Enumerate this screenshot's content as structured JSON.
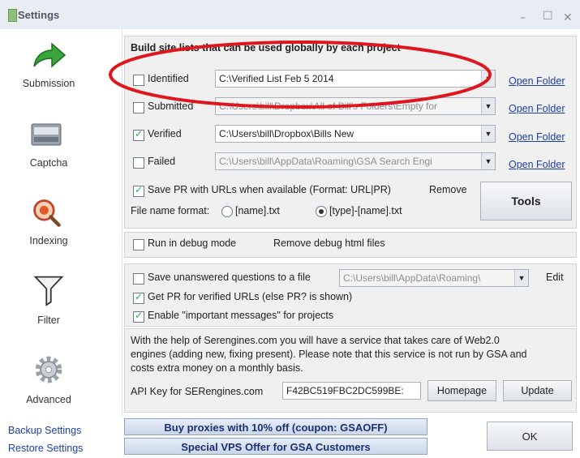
{
  "window": {
    "title": "Settings",
    "minimize": "–",
    "maximize": "☐",
    "close": "✕"
  },
  "sidebar": {
    "items": [
      {
        "label": "Submission",
        "icon": "arrow-right-icon"
      },
      {
        "label": "Captcha",
        "icon": "captcha-icon"
      },
      {
        "label": "Indexing",
        "icon": "indexing-icon"
      },
      {
        "label": "Filter",
        "icon": "filter-funnel-icon"
      },
      {
        "label": "Advanced",
        "icon": "gear-icon"
      }
    ],
    "backup": "Backup Settings",
    "restore": "Restore Settings"
  },
  "sitelists": {
    "heading": "Build site lists that can be used globally by each project",
    "rows": [
      {
        "label": "Identified",
        "checked": false,
        "path": "C:\\Verified List Feb 5 2014",
        "enabled": true,
        "link": "Open Folder"
      },
      {
        "label": "Submitted",
        "checked": false,
        "path": "C:\\Users\\bill\\Dropbox\\All of Bill's Folders\\Empty for",
        "enabled": false,
        "link": "Open Folder"
      },
      {
        "label": "Verified",
        "checked": true,
        "path": "C:\\Users\\bill\\Dropbox\\Bills New",
        "enabled": true,
        "link": "Open Folder"
      },
      {
        "label": "Failed",
        "checked": false,
        "path": "C:\\Users\\bill\\AppData\\Roaming\\GSA Search Engi",
        "enabled": false,
        "link": "Open Folder"
      }
    ],
    "save_pr": "Save PR with URLs when available (Format: URL|PR)",
    "remove": "Remove",
    "file_name_format_label": "File name format:",
    "format_option_1": "[name].txt",
    "format_option_2": "[type]-[name].txt",
    "tools": "Tools"
  },
  "debug": {
    "run_debug": "Run in debug mode",
    "remove_debug": "Remove debug html files"
  },
  "options": {
    "save_unanswered": "Save unanswered questions to a file",
    "unanswered_path": "C:\\Users\\bill\\AppData\\Roaming\\",
    "edit": "Edit",
    "get_pr": "Get PR for verified URLs (else PR? is shown)",
    "important": "Enable \"important messages\" for projects"
  },
  "serengines": {
    "text_1": "With the help of Serengines.com you will have a service that takes care of Web2.0",
    "text_2": "engines (adding new, fixing present). Please note that this service is not run by GSA and",
    "text_3": "costs extra money on a monthly basis.",
    "api_label": "API Key for SERengines.com",
    "api_value": "F42BC519FBC2DC599BE:",
    "homepage": "Homepage",
    "update": "Update"
  },
  "promo": {
    "proxies": "Buy proxies with 10% off  (coupon: GSAOFF)",
    "vps": "Special VPS Offer for GSA Customers"
  },
  "ok": "OK",
  "colors": {
    "annotation_red": "#e0161e",
    "green_decor": "#45c98a",
    "link": "#1d3fa8"
  }
}
